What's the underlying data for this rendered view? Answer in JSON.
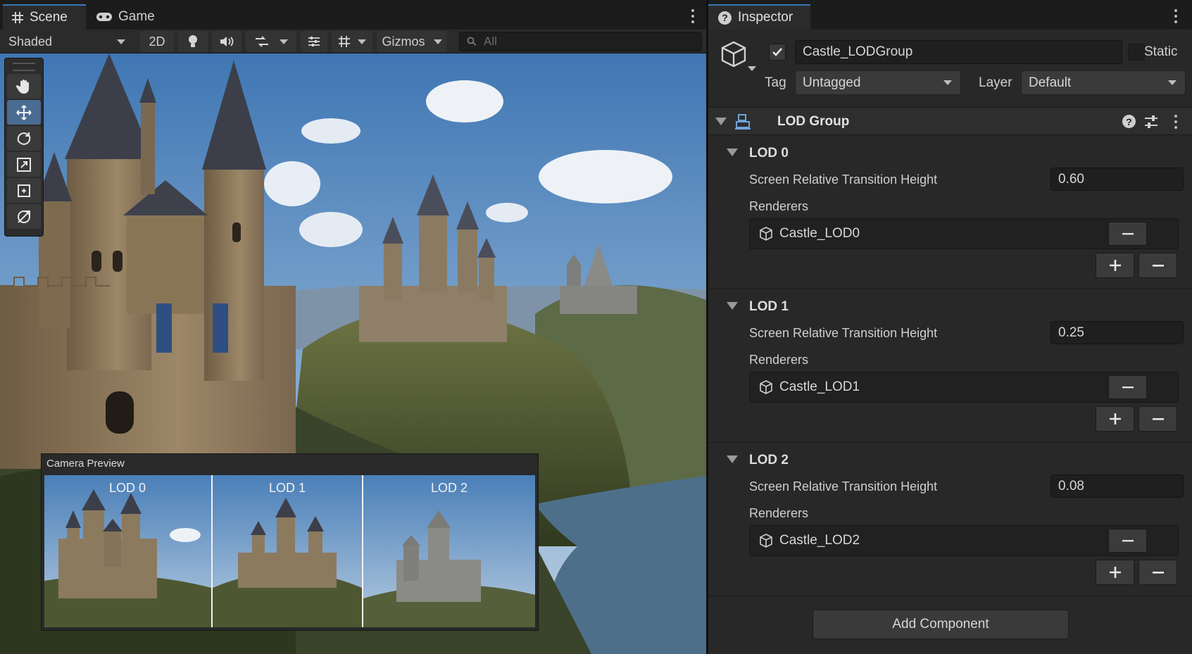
{
  "scene_panel": {
    "tabs": [
      {
        "label": "Scene",
        "icon": "hash-grid-icon",
        "active": true
      },
      {
        "label": "Game",
        "icon": "gamepad-icon",
        "active": false
      }
    ],
    "toolbar": {
      "shading_mode": "Shaded",
      "mode_2d": "2D",
      "gizmos_label": "Gizmos",
      "search_placeholder": "All"
    },
    "tools": [
      "hand-tool",
      "move-tool",
      "rotate-tool",
      "scale-tool",
      "rect-tool",
      "transform-tool"
    ],
    "camera_preview": {
      "title": "Camera Preview",
      "panels": [
        {
          "label": "LOD 0"
        },
        {
          "label": "LOD 1"
        },
        {
          "label": "LOD 2"
        }
      ]
    }
  },
  "inspector": {
    "tab_label": "Inspector",
    "object_name": "Castle_LODGroup",
    "object_enabled": true,
    "static_label": "Static",
    "tag_label": "Tag",
    "tag_value": "Untagged",
    "layer_label": "Layer",
    "layer_value": "Default",
    "component_title": "LOD Group",
    "lods": [
      {
        "title": "LOD 0",
        "transition_label": "Screen Relative Transition Height",
        "transition_value": "0.60",
        "renderers_label": "Renderers",
        "renderer": "Castle_LOD0"
      },
      {
        "title": "LOD 1",
        "transition_label": "Screen Relative Transition Height",
        "transition_value": "0.25",
        "renderers_label": "Renderers",
        "renderer": "Castle_LOD1"
      },
      {
        "title": "LOD 2",
        "transition_label": "Screen Relative Transition Height",
        "transition_value": "0.08",
        "renderers_label": "Renderers",
        "renderer": "Castle_LOD2"
      }
    ],
    "add_component_label": "Add Component"
  },
  "colors": {
    "accent": "#3a79bb",
    "panel_bg": "#282828",
    "field_bg": "#1f1f1f",
    "sky": "#4a7fb8"
  }
}
